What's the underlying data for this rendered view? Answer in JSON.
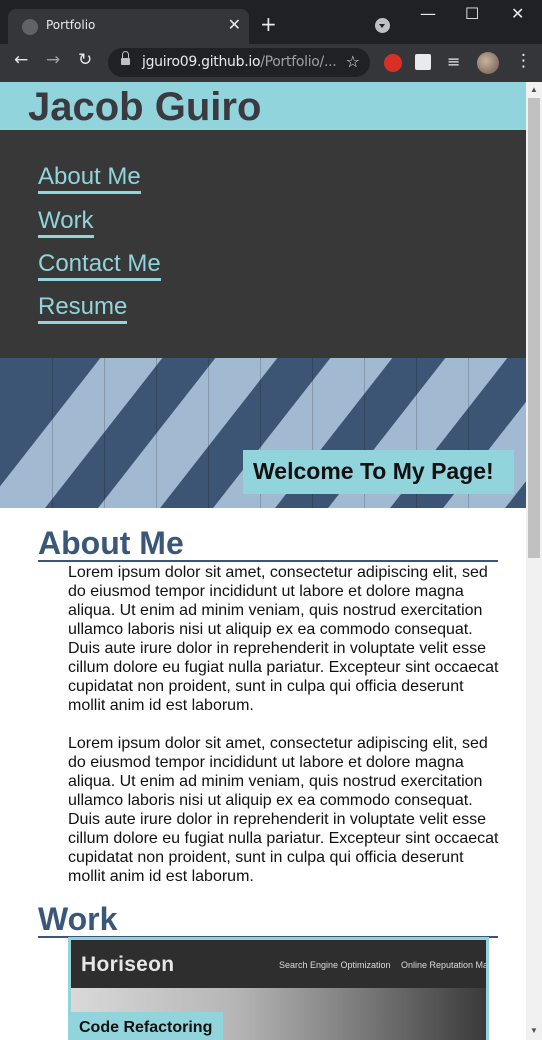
{
  "browser": {
    "tab_title": "Portfolio",
    "tab_close": "✕",
    "new_tab": "+",
    "url_host": "jguiro09.github.io",
    "url_path": "/Portfolio/...",
    "back": "←",
    "forward": "→",
    "reload": "↻",
    "bookmark": "☆",
    "media": "≡",
    "menu": "⋮",
    "window_minimize": "—",
    "window_maximize": "☐",
    "window_close": "✕",
    "icons": [
      "globe-icon",
      "close-icon",
      "plus-icon",
      "tab-search-icon",
      "back-arrow-icon",
      "forward-arrow-icon",
      "reload-icon",
      "lock-icon",
      "star-icon",
      "extension-block-icon",
      "puzzle-icon",
      "media-queue-icon",
      "profile-avatar",
      "kebab-menu-icon"
    ]
  },
  "site": {
    "title": "Jacob Guiro",
    "nav": [
      "About Me",
      "Work",
      "Contact Me",
      "Resume"
    ],
    "hero_badge": "Welcome To My Page!",
    "about": {
      "heading": "About Me",
      "paragraphs": [
        "Lorem ipsum dolor sit amet, consectetur adipiscing elit, sed do eiusmod tempor incididunt ut labore et dolore magna aliqua. Ut enim ad minim veniam, quis nostrud exercitation ullamco laboris nisi ut aliquip ex ea commodo consequat. Duis aute irure dolor in reprehenderit in voluptate velit esse cillum dolore eu fugiat nulla pariatur. Excepteur sint occaecat cupidatat non proident, sunt in culpa qui officia deserunt mollit anim id est laborum.",
        "Lorem ipsum dolor sit amet, consectetur adipiscing elit, sed do eiusmod tempor incididunt ut labore et dolore magna aliqua. Ut enim ad minim veniam, quis nostrud exercitation ullamco laboris nisi ut aliquip ex ea commodo consequat. Duis aute irure dolor in reprehenderit in voluptate velit esse cillum dolore eu fugiat nulla pariatur. Excepteur sint occaecat cupidatat non proident, sunt in culpa qui officia deserunt mollit anim id est laborum."
      ]
    },
    "work": {
      "heading": "Work",
      "card": {
        "brand": "Horiseon",
        "nav_items": [
          "Search Engine Optimization",
          "Online Reputation Ma"
        ],
        "label": "Code Refactoring"
      }
    }
  },
  "colors": {
    "accent": "#92d4db",
    "nav_bg": "#383838",
    "heading": "#3b5778",
    "title_text": "#3a3a40"
  }
}
